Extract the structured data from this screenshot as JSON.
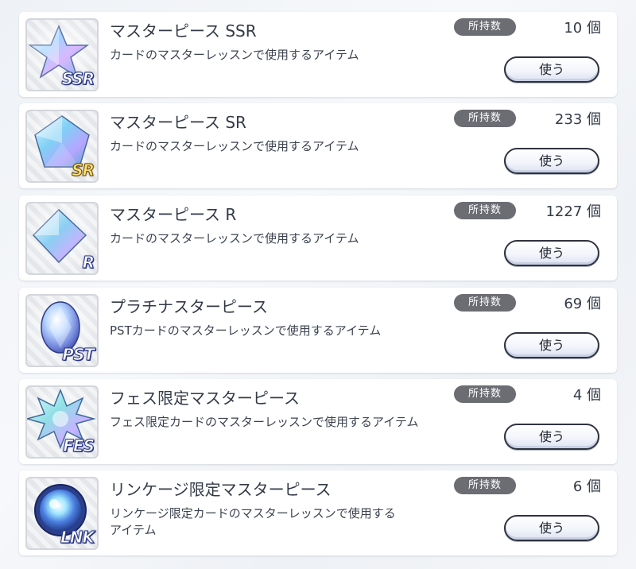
{
  "items": [
    {
      "name": "マスターピース SSR",
      "description": "カードのマスターレッスンで使用するアイテム",
      "owned_label": "所持数",
      "count": "10 個",
      "button_label": "使う",
      "rarity": "SSR",
      "icon": "star-crystal-icon"
    },
    {
      "name": "マスターピース SR",
      "description": "カードのマスターレッスンで使用するアイテム",
      "owned_label": "所持数",
      "count": "233 個",
      "button_label": "使う",
      "rarity": "SR",
      "icon": "pentagon-crystal-icon"
    },
    {
      "name": "マスターピース R",
      "description": "カードのマスターレッスンで使用するアイテム",
      "owned_label": "所持数",
      "count": "1227 個",
      "button_label": "使う",
      "rarity": "R",
      "icon": "square-crystal-icon"
    },
    {
      "name": "プラチナスターピース",
      "description": "PSTカードのマスターレッスンで使用するアイテム",
      "owned_label": "所持数",
      "count": "69 個",
      "button_label": "使う",
      "rarity": "PST",
      "icon": "oval-gem-icon"
    },
    {
      "name": "フェス限定マスターピース",
      "description": "フェス限定カードのマスターレッスンで使用するアイテム",
      "owned_label": "所持数",
      "count": "4 個",
      "button_label": "使う",
      "rarity": "FES",
      "icon": "starburst-crystal-icon"
    },
    {
      "name": "リンケージ限定マスターピース",
      "description": "リンケージ限定カードのマスターレッスンで使用するアイテム",
      "owned_label": "所持数",
      "count": "6 個",
      "button_label": "使う",
      "rarity": "LNK",
      "icon": "orb-crystal-icon"
    }
  ],
  "colors": {
    "badge_bg": "#6b6d73",
    "card_bg": "#ffffff",
    "button_border": "#2f3340",
    "text": "#333a47"
  }
}
